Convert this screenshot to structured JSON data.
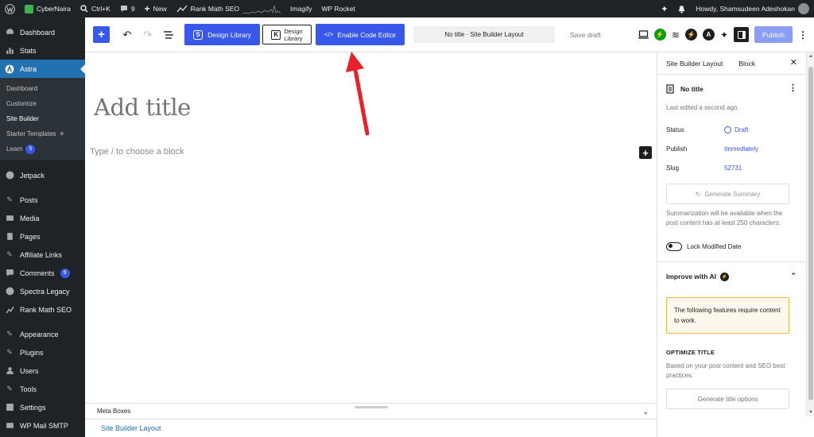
{
  "admin_bar": {
    "site_name": "CyberNaira",
    "search_shortcut": "Ctrl+K",
    "comments_count": "9",
    "new_label": "New",
    "rank_math": "Rank Math SEO",
    "imagify": "Imagify",
    "wp_rocket": "WP Rocket",
    "howdy": "Howdy, Shamsudeen Adeshokan"
  },
  "sidebar": {
    "items_top": [
      {
        "label": "Dashboard",
        "icon": "dashboard-icon"
      },
      {
        "label": "Stats",
        "icon": "stats-icon"
      },
      {
        "label": "Astra",
        "icon": "astra-icon",
        "active": true
      }
    ],
    "submenu": [
      {
        "label": "Dashboard"
      },
      {
        "label": "Customize"
      },
      {
        "label": "Site Builder",
        "current": true
      },
      {
        "label": "Starter Templates",
        "icon": "sparkle-icon"
      },
      {
        "label": "Learn",
        "badge": "5"
      }
    ],
    "items_bottom": [
      {
        "label": "Jetpack",
        "icon": "jetpack-icon"
      },
      {
        "label": "Posts",
        "icon": "pin-icon"
      },
      {
        "label": "Media",
        "icon": "media-icon"
      },
      {
        "label": "Pages",
        "icon": "pages-icon"
      },
      {
        "label": "Affiliate Links",
        "icon": "link-icon"
      },
      {
        "label": "Comments",
        "icon": "comment-icon",
        "badge": "9"
      },
      {
        "label": "Spectra Legacy",
        "icon": "spectra-icon"
      },
      {
        "label": "Rank Math SEO",
        "icon": "rankmath-icon"
      },
      {
        "label": "Appearance",
        "icon": "brush-icon"
      },
      {
        "label": "Plugins",
        "icon": "plug-icon"
      },
      {
        "label": "Users",
        "icon": "users-icon"
      },
      {
        "label": "Tools",
        "icon": "wrench-icon"
      },
      {
        "label": "Settings",
        "icon": "settings-icon"
      },
      {
        "label": "WP Mail SMTP",
        "icon": "mail-icon"
      }
    ]
  },
  "toolbar": {
    "design_library": "Design Library",
    "design_library_2_line1": "Design",
    "design_library_2_line2": "Library",
    "enable_code_editor": "Enable Code Editor",
    "doc_title": "No title · Site Builder Layout",
    "save_draft": "Save draft",
    "publish": "Publish"
  },
  "editor": {
    "title_placeholder": "Add title",
    "block_placeholder": "Type / to choose a block",
    "meta_boxes": "Meta Boxes",
    "breadcrumb": "Site Builder Layout"
  },
  "panel": {
    "tab_layout": "Site Builder Layout",
    "tab_block": "Block",
    "doc_name": "No title",
    "last_edited": "Last edited a second ago.",
    "status_label": "Status",
    "status_value": "Draft",
    "publish_label": "Publish",
    "publish_value": "Immediately",
    "slug_label": "Slug",
    "slug_value": "52731",
    "generate_summary": "Generate Summary",
    "summary_note": "Summarization will be available when the post content has at least 250 characters.",
    "lock_modified": "Lock Modified Date",
    "improve_ai": "Improve with AI",
    "notice": "The following features require content to work.",
    "optimize_title": "OPTIMIZE TITLE",
    "optimize_desc": "Based on your post content and SEO best practices.",
    "generate_title": "Generate title options"
  },
  "colors": {
    "accent": "#3858e9",
    "admin_dark": "#1d2327",
    "active_menu": "#2271b1",
    "annotation_arrow": "#e8202a"
  }
}
